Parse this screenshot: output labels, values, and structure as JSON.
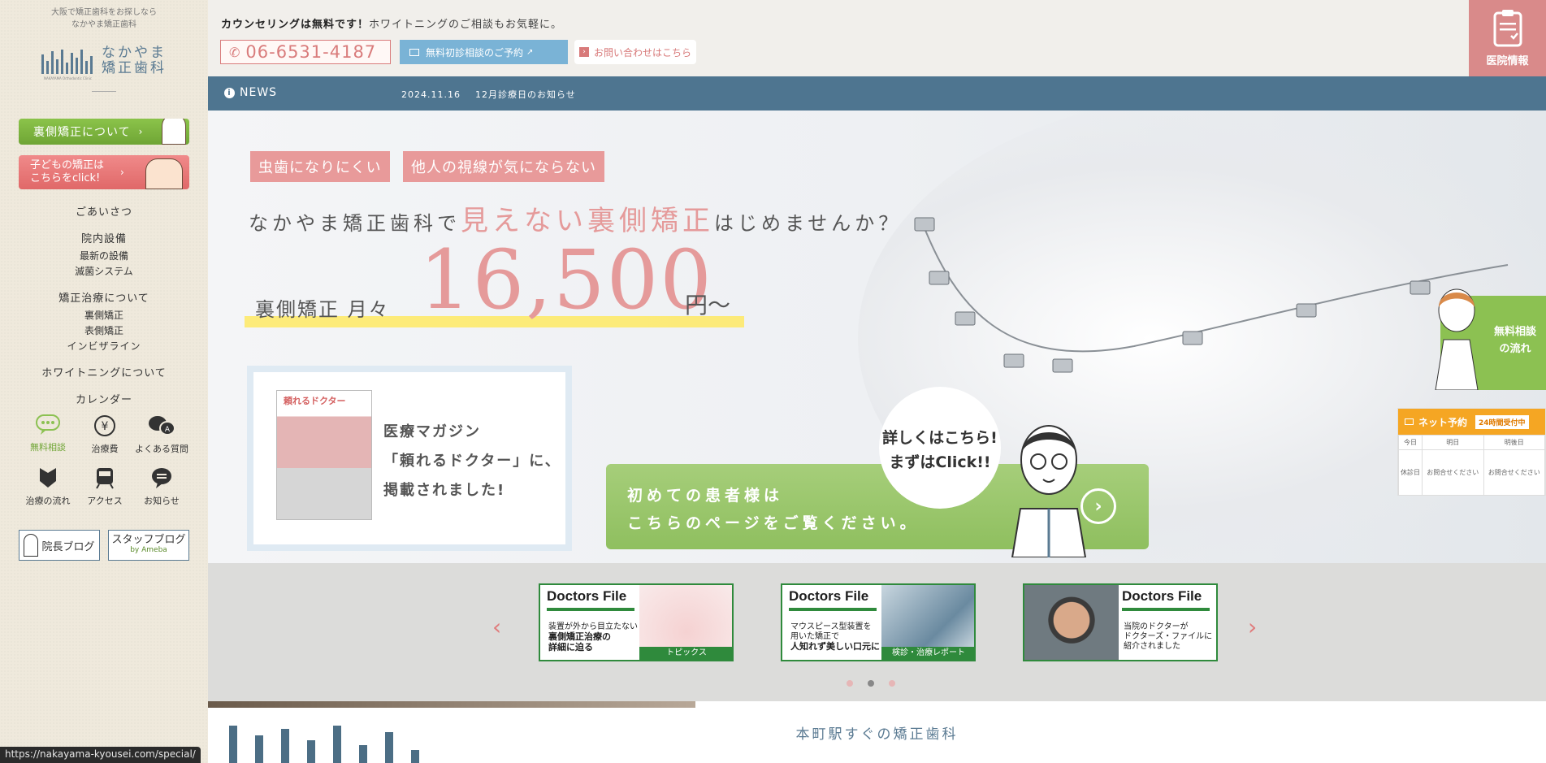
{
  "sidebar": {
    "tagline1": "大阪で矯正歯科をお探しなら",
    "tagline2": "なかやま矯正歯科",
    "logo_name1": "なかやま",
    "logo_name2": "矯正歯科",
    "logo_sub": "NAKAYAMA Orthodontic Clinic",
    "btn_lingual": "裏側矯正について",
    "btn_kids1": "子どもの矯正は",
    "btn_kids2": "こちらをclick!",
    "nav": {
      "greeting": "ごあいさつ",
      "facility": "院内設備",
      "latest_equipment": "最新の設備",
      "sterilization": "滅菌システム",
      "ortho_about": "矯正治療について",
      "lingual": "裏側矯正",
      "labial": "表側矯正",
      "invisalign": "インビザライン",
      "whitening": "ホワイトニングについて",
      "calendar": "カレンダー"
    },
    "icons": [
      {
        "label": "無料相談",
        "icon": "chat-icon",
        "color": "#8cc152"
      },
      {
        "label": "治療費",
        "icon": "yen-icon",
        "color": "#333333"
      },
      {
        "label": "よくある質問",
        "icon": "qa-icon",
        "color": "#333333"
      },
      {
        "label": "治療の流れ",
        "icon": "flow-icon",
        "color": "#333333"
      },
      {
        "label": "アクセス",
        "icon": "train-icon",
        "color": "#333333"
      },
      {
        "label": "お知らせ",
        "icon": "news-icon",
        "color": "#333333"
      }
    ],
    "blog_director": "院長ブログ",
    "blog_staff": "スタッフブログ",
    "blog_staff_sub": "by Ameba"
  },
  "header": {
    "counsel_bold": "カウンセリングは無料です！",
    "counsel_rest": "ホワイトニングのご相談もお気軽に。",
    "phone": "06-6531-4187",
    "reserve": "無料初診相談のご予約",
    "contact": "お問い合わせはこちら",
    "clinic_info": "医院情報"
  },
  "news": {
    "label": "NEWS",
    "date": "2024.11.16",
    "title": "12月診療日のお知らせ"
  },
  "hero": {
    "tag1": "虫歯になりにくい",
    "tag2": "他人の視線が気にならない",
    "headline_a": "なかやま矯正歯科で",
    "headline_b": "見えない裏側矯正",
    "headline_c": "はじめませんか？",
    "price_label": "裏側矯正 月々",
    "price": "16,500",
    "price_unit": "円〜",
    "magazine_title": "頼れるドクター",
    "magazine_line1": "医療マガジン",
    "magazine_line2": "「頼れるドクター」に、",
    "magazine_line3": "掲載されました!",
    "bubble1": "詳しくはこちら!",
    "bubble2": "まずはClick!!",
    "first_line1": "初めての患者様は",
    "first_line2": "こちらのページをご覧ください。"
  },
  "floating": {
    "consult1": "無料相談",
    "consult2": "の流れ",
    "net_title": "ネット予約",
    "net_badge": "24時間受付中",
    "days": [
      "今日",
      "明日",
      "明後日"
    ],
    "status": [
      "休診日",
      "お問合せください",
      "お問合せください"
    ]
  },
  "carousel": {
    "cards": [
      {
        "title": "Doctors File",
        "l1": "装置が外から目立たない",
        "l2": "裏側矯正治療の",
        "l3": "詳細に迫る",
        "tag": "トピックス"
      },
      {
        "title": "Doctors File",
        "l1": "マウスピース型装置を",
        "l2": "用いた矯正で",
        "l3": "人知れず美しい口元に",
        "tag": "検診・治療レポート"
      },
      {
        "title": "Doctors File",
        "l1": "当院のドクターが",
        "l2": "ドクターズ・ファイルに",
        "l3": "紹介されました",
        "tag": ""
      }
    ],
    "prev": "‹",
    "next": "›"
  },
  "bottom": {
    "title": "本町駅すぐの矯正歯科"
  },
  "status_url": "https://nakayama-kyousei.com/special/"
}
